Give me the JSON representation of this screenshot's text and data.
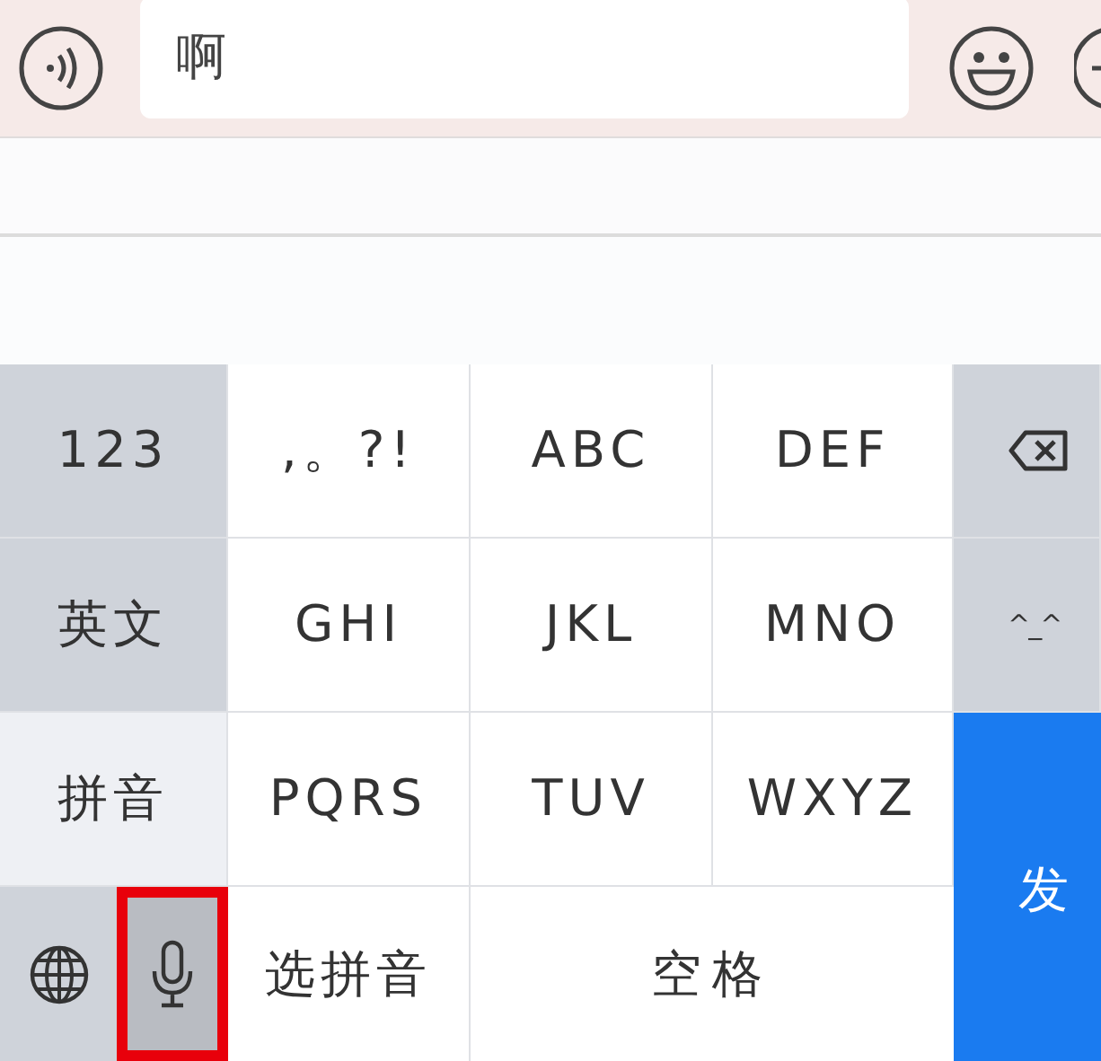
{
  "chat_bar": {
    "message": "啊"
  },
  "keyboard": {
    "rows": [
      [
        {
          "kind": "func",
          "label": "123"
        },
        {
          "kind": "char",
          "label": ",。?!"
        },
        {
          "kind": "char",
          "label": "ABC"
        },
        {
          "kind": "char",
          "label": "DEF"
        },
        {
          "kind": "backspace"
        }
      ],
      [
        {
          "kind": "func",
          "label": "英文"
        },
        {
          "kind": "char",
          "label": "GHI"
        },
        {
          "kind": "char",
          "label": "JKL"
        },
        {
          "kind": "char",
          "label": "MNO"
        },
        {
          "kind": "func",
          "label": "^_^"
        }
      ],
      [
        {
          "kind": "light",
          "label": "拼音"
        },
        {
          "kind": "char",
          "label": "PQRS"
        },
        {
          "kind": "char",
          "label": "TUV"
        },
        {
          "kind": "char",
          "label": "WXYZ"
        }
      ]
    ],
    "bottom": {
      "globe": {
        "highlighted": false
      },
      "mic": {
        "highlighted": true
      },
      "pinyin": "选拼音",
      "space": "空格"
    },
    "send": "发"
  }
}
